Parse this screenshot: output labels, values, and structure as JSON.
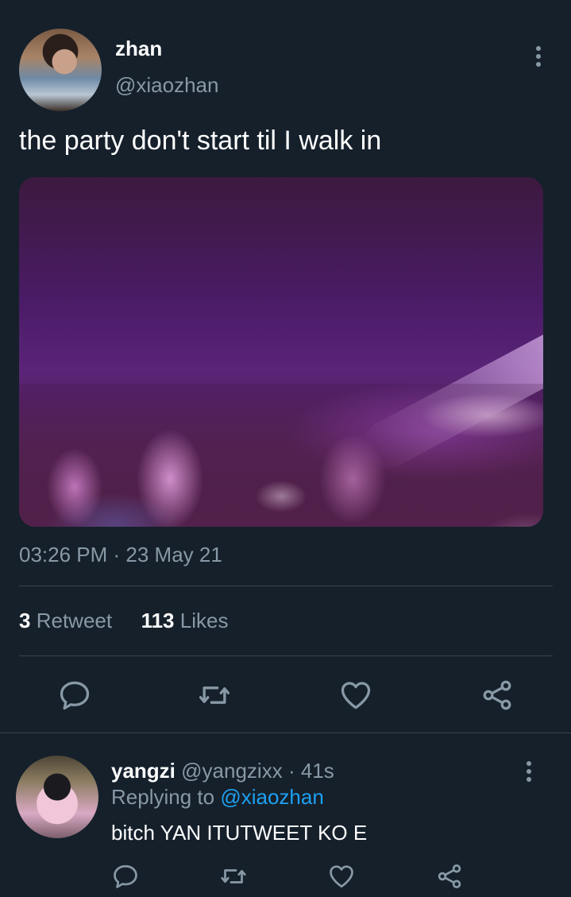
{
  "tweet": {
    "author_name": "zhan",
    "author_handle": "@xiaozhan",
    "text": "the party don't start til I walk in",
    "time": "03:26 PM",
    "date": "23 May 21",
    "retweet_count": "3",
    "retweet_label": "Retweet",
    "like_count": "113",
    "like_label": "Likes"
  },
  "reply": {
    "author_name": "yangzi",
    "author_handle": "@yangzixx",
    "age": "41s",
    "replying_prefix": "Replying to",
    "replying_to": "@xiaozhan",
    "text": "bitch YAN ITUTWEET KO E"
  },
  "icons": {
    "reply": "reply-icon",
    "retweet": "retweet-icon",
    "like": "heart-icon",
    "share": "share-icon",
    "more": "more-vertical-icon"
  },
  "colors": {
    "background": "#15202b",
    "secondary_text": "#8899a6",
    "link": "#1da1f2",
    "divider": "#38444d"
  }
}
